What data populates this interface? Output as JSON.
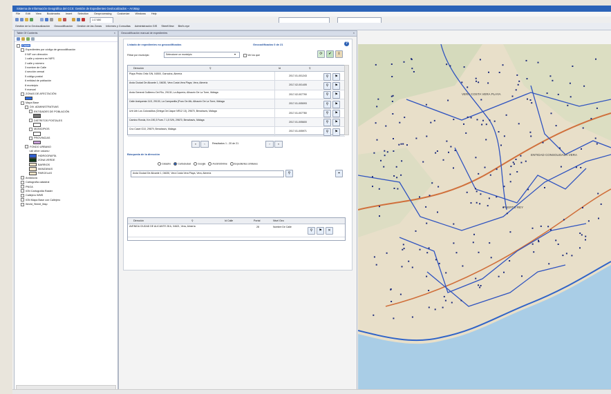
{
  "window": {
    "title": "Sistema de Información Geográfica del CCS: Gestión de Expedientes Geolocalizados – ArcMap",
    "menus": [
      "File",
      "Edit",
      "View",
      "Bookmarks",
      "Insert",
      "Selection",
      "Geoprocessing",
      "Customize",
      "Windows",
      "Help"
    ],
    "scale": "1:17.650",
    "toolbar_tabs": [
      "Gestión de la Geolocalización",
      "Geocodificación",
      "Gestión de las Zonas",
      "Informes y Consultas",
      "Administración GIS",
      "StreetView",
      "Bird's eye"
    ]
  },
  "toc": {
    "title": "Table Of Contents",
    "root": "Capas",
    "items": [
      {
        "label": "Expedientes por código de geocodificación",
        "level": 1,
        "check": true
      },
      {
        "label": "0 NIF con dirección",
        "level": 2
      },
      {
        "label": "1 calle y número en NIFS",
        "level": 2
      },
      {
        "label": "2 calle y número",
        "level": 2
      },
      {
        "label": "3 nombre de Calle",
        "level": 2
      },
      {
        "label": "4 sección censal",
        "level": 2
      },
      {
        "label": "5 código postal",
        "level": 2
      },
      {
        "label": "6 entidad de población",
        "level": 2
      },
      {
        "label": "8 municipio",
        "level": 2
      },
      {
        "label": "9 manual",
        "level": 2
      },
      {
        "label": "ZONAS DE AFECTACIÓN",
        "level": 1,
        "check": true
      },
      {
        "label": "",
        "level": 2,
        "swatch": "#2f6fe0"
      },
      {
        "label": "Mapa Base",
        "level": 1,
        "check": true
      },
      {
        "label": "DIV. ADMINISTRATIVAS",
        "level": 2,
        "check": true
      },
      {
        "label": "ENTIDADES DE POBLACIÓN",
        "level": 3,
        "check": true
      },
      {
        "label": "",
        "level": 4,
        "swatch": "#777777"
      },
      {
        "label": "DISTRITOS POSTALES",
        "level": 3,
        "check": true
      },
      {
        "label": "",
        "level": 4,
        "swatch": "#ffffff"
      },
      {
        "label": "MUNICIPIOS",
        "level": 3,
        "check": true
      },
      {
        "label": "",
        "level": 4,
        "swatch": "#ffffff"
      },
      {
        "label": "PROVINCIAS",
        "level": 3,
        "check": true
      },
      {
        "label": "",
        "level": 4,
        "swatch": "#c8a0d8"
      },
      {
        "label": "FONDO URBANO",
        "level": 2,
        "check": true
      },
      {
        "label": "<all other values>",
        "level": 3
      },
      {
        "label": "HIDROGRAFÍA",
        "level": 3,
        "swatch": "#2f5fd0"
      },
      {
        "label": "ZONA VERDE",
        "level": 3,
        "swatch": "#103818"
      },
      {
        "label": "BARRIOS",
        "level": 3,
        "swatch": "#f0e4c8"
      },
      {
        "label": "MANZANAS",
        "level": 3,
        "swatch": "#f0e4c8"
      },
      {
        "label": "PARCELAS",
        "level": 3,
        "swatch": "#f0e4c8"
      },
      {
        "label": "Andalucía",
        "level": 1,
        "check": true
      },
      {
        "label": "Cartografía catastral",
        "level": 1,
        "check": true
      },
      {
        "label": "PNOA",
        "level": 1,
        "check": true
      },
      {
        "label": "IGN Cartografía Raster",
        "level": 1,
        "check": true
      },
      {
        "label": "Callejero WMS",
        "level": 1,
        "check": true
      },
      {
        "label": "IGN Mapa Base con Callejero",
        "level": 1,
        "check": true
      },
      {
        "label": "World_Street_Map",
        "level": 1,
        "check": true
      }
    ]
  },
  "panel": {
    "title": "Geocodificación manual de expedientes",
    "heading": "Listado de expedientes no geocodificados",
    "pending": "Geocodificados 0 de 21",
    "filter_label": "Filtrar por municipio",
    "filter_value": "Seleccione un municipio",
    "checkbox_label": "Ver los que",
    "columns": [
      "Dirección",
      "Id"
    ],
    "rows": [
      {
        "addr": "Playa Pedro Ortiz S/N, 04500, Garrucha, Almería",
        "id": "2017-01-001243"
      },
      {
        "addr": "Avda Ciudad De Alicante 1, 04630, Vera Costa Vera Playa, Vera, Almería",
        "id": "2017-02-001405"
      },
      {
        "addr": "Avda General Guillermo Del Río, 29130, La Alquería, Alhaurín De La Torre, Málaga",
        "id": "2017-02-007790"
      },
      {
        "addr": "Calle Aralquesta 11/3, 29130, La Campanilla (Pozo De Alb, Alhaurín De La Torre, Málaga",
        "id": "2017-01-005093"
      },
      {
        "addr": "Urb Urb Los Coloraditos (Ortega Del Jaque NR12 13), 29670, Benahavís, Málaga",
        "id": "2017-01-007780"
      },
      {
        "addr": "Camino Ronda, Km 190,3 Fuen-7 1,5 S/N, 29670, Benahavís, Málaga",
        "id": "2017-01-005600"
      },
      {
        "addr": "Cno Casei G10, 29679, Benahavís, Málaga",
        "id": "2017-01-005971"
      }
    ],
    "pagination": "Resultados 1 - 20 de 21",
    "search_heading": "Búsqueda de la dirección",
    "radio_options": [
      "Catastro",
      "Cartociudad",
      "Google",
      "ArcGISOnline",
      "Expedientes similares"
    ],
    "radio_selected": 1,
    "search_value": "Avda Ciudad De Alicante 1, 04630, Vera Costa Vera Playa, Vera, Almería",
    "result_columns": [
      "Dirección",
      "Id Calle",
      "Portal",
      "Nivel Geo"
    ],
    "result_row": {
      "addr": "AVENIDA CIUDAD DE ALICANTE 28 A, 04621, Vera, Almería",
      "id": "",
      "portal": "28",
      "nivel": "Nombre De Calle"
    }
  },
  "map": {
    "labels": [
      "VERA COSTA VERA PLAYA",
      "PUERTO REY",
      "ENTIDAD CONSOLIDADA VERA"
    ]
  }
}
